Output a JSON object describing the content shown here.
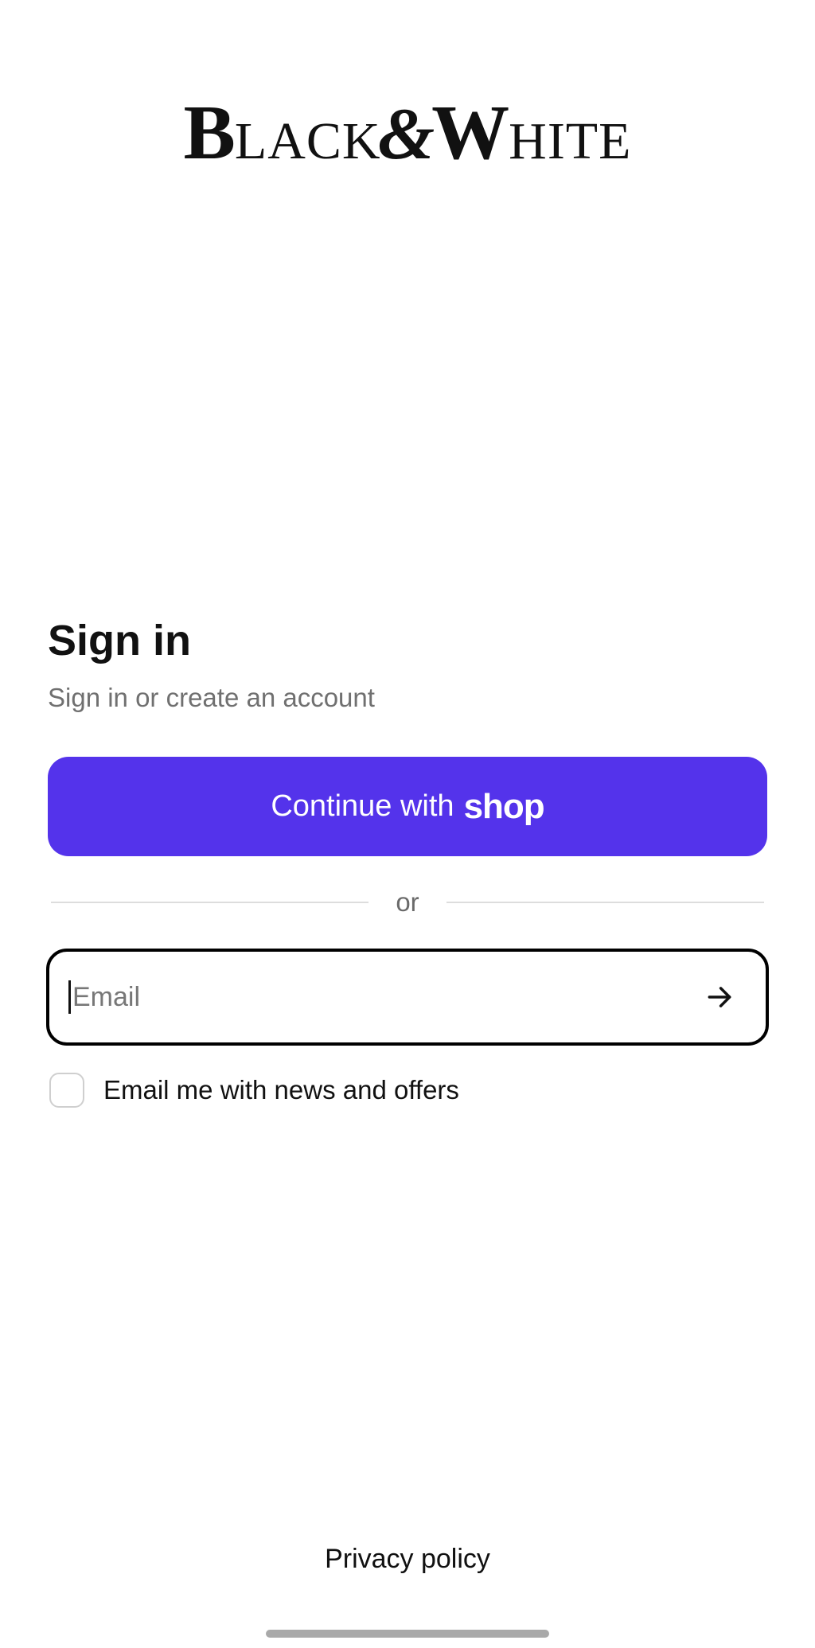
{
  "brand": {
    "logo_parts": [
      "B",
      "LACK",
      "&",
      "W",
      "HITE"
    ]
  },
  "signin": {
    "title": "Sign in",
    "subtitle": "Sign in or create an account",
    "shop_button_text": "Continue with",
    "shop_button_brand": "shop",
    "divider_text": "or",
    "email_placeholder": "Email",
    "email_value": "",
    "newsletter_label": "Email me with news and offers",
    "newsletter_checked": false
  },
  "footer": {
    "privacy_link": "Privacy policy"
  },
  "colors": {
    "shop_purple": "#5433eb",
    "text_primary": "#111111",
    "text_secondary": "#707070"
  },
  "icons": {
    "submit": "arrow-right-icon"
  }
}
